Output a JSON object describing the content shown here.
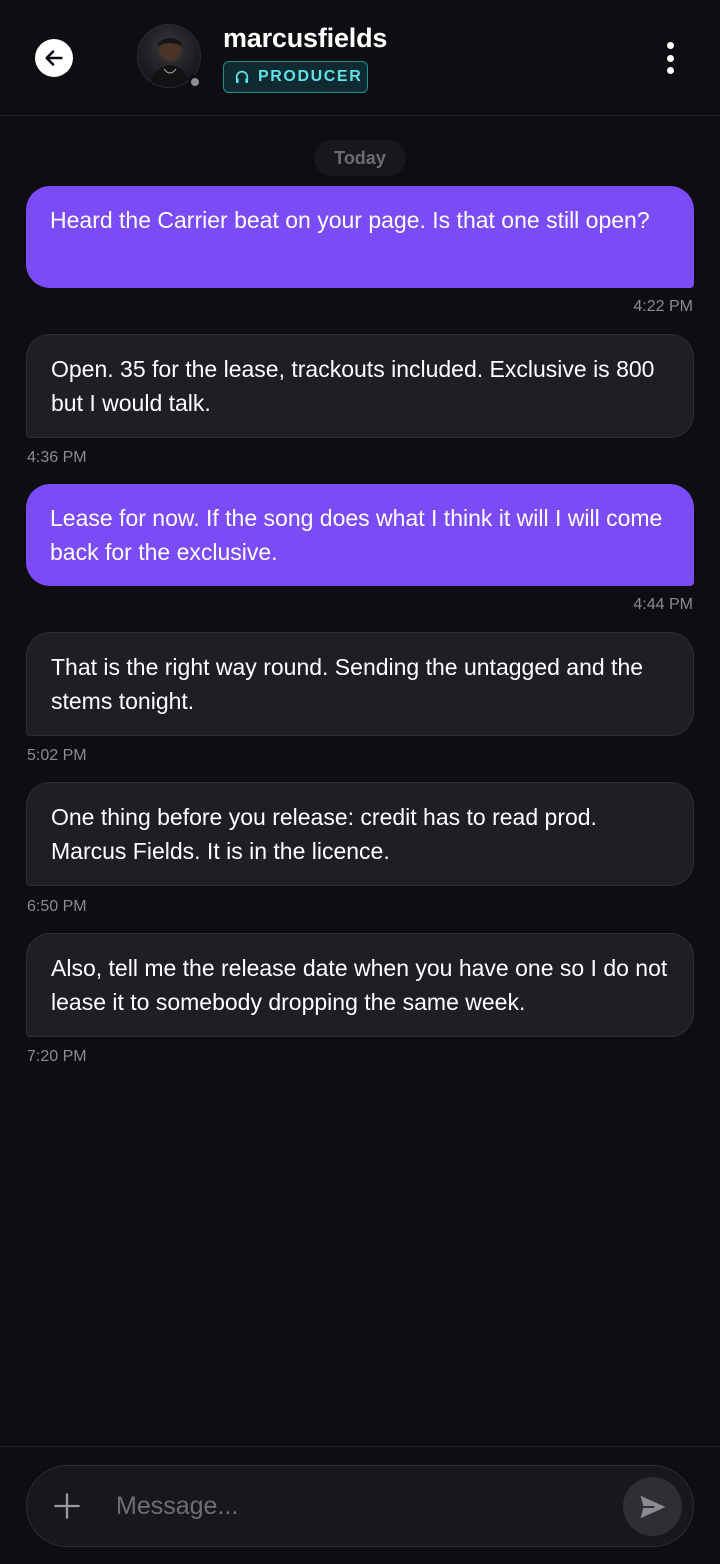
{
  "header": {
    "username": "marcusfields",
    "role": "PRODUCER",
    "icons": {
      "back": "arrow-left-icon",
      "role": "headphones-icon",
      "more": "more-vertical-icon"
    },
    "accent": "#5fe3e8"
  },
  "date_separator": "Today",
  "messages": [
    {
      "direction": "outgoing",
      "text": "Heard the Carrier beat on your page. Is that one still open?",
      "time": "4:22 PM"
    },
    {
      "direction": "incoming",
      "text": "Open. 35 for the lease, trackouts included. Exclusive is 800 but I would talk.",
      "time": "4:36 PM"
    },
    {
      "direction": "outgoing",
      "text": "Lease for now. If the song does what I think it will I will come back for the exclusive.",
      "time": "4:44 PM"
    },
    {
      "direction": "incoming",
      "text": "That is the right way round. Sending the untagged and the stems tonight.",
      "time": "5:02 PM"
    },
    {
      "direction": "incoming",
      "text": "One thing before you release: credit has to read prod. Marcus Fields. It is in the licence.",
      "time": "6:50 PM"
    },
    {
      "direction": "incoming",
      "text": "Also, tell me the release date when you have one so I do not lease it to somebody dropping the same week.",
      "time": "7:20 PM"
    }
  ],
  "composer": {
    "placeholder": "Message...",
    "value": "",
    "icons": {
      "attach": "plus-icon",
      "send": "send-icon"
    }
  },
  "colors": {
    "outgoing_bubble": "#7b4cf6",
    "incoming_bubble": "#1e1e24",
    "background": "#0d0d12"
  }
}
